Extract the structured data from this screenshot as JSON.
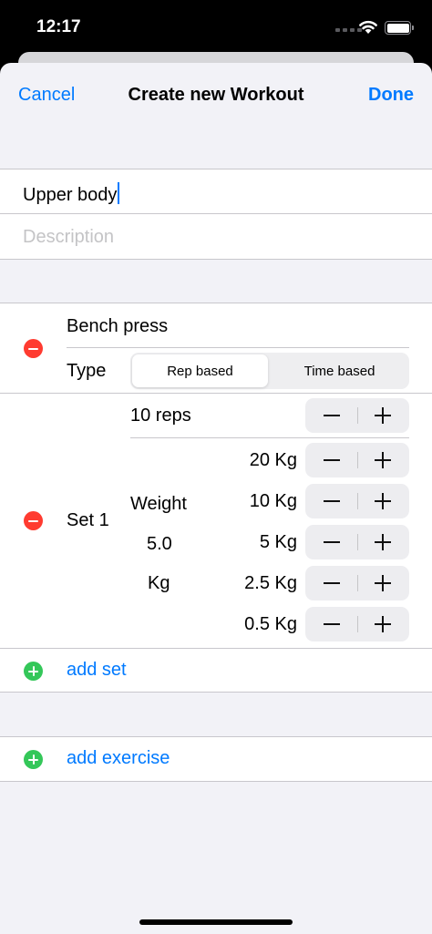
{
  "status_bar": {
    "time": "12:17"
  },
  "nav": {
    "cancel_label": "Cancel",
    "title": "Create new Workout",
    "done_label": "Done"
  },
  "workout": {
    "name_value": "Upper body",
    "description_placeholder": "Description"
  },
  "exercise": {
    "name": "Bench press",
    "type_label": "Type",
    "type_options": [
      "Rep based",
      "Time based"
    ],
    "type_selected": "Rep based",
    "set": {
      "label": "Set 1",
      "reps": "10 reps",
      "weight_label": "Weight",
      "weight_value": "5.0",
      "weight_unit": "Kg",
      "increments": [
        "20 Kg",
        "10 Kg",
        "5 Kg",
        "2.5 Kg",
        "0.5 Kg"
      ]
    },
    "add_set_label": "add set"
  },
  "add_exercise_label": "add exercise",
  "colors": {
    "accent": "#007aff",
    "delete": "#ff3b30",
    "add": "#34c759",
    "background": "#f2f2f7"
  }
}
